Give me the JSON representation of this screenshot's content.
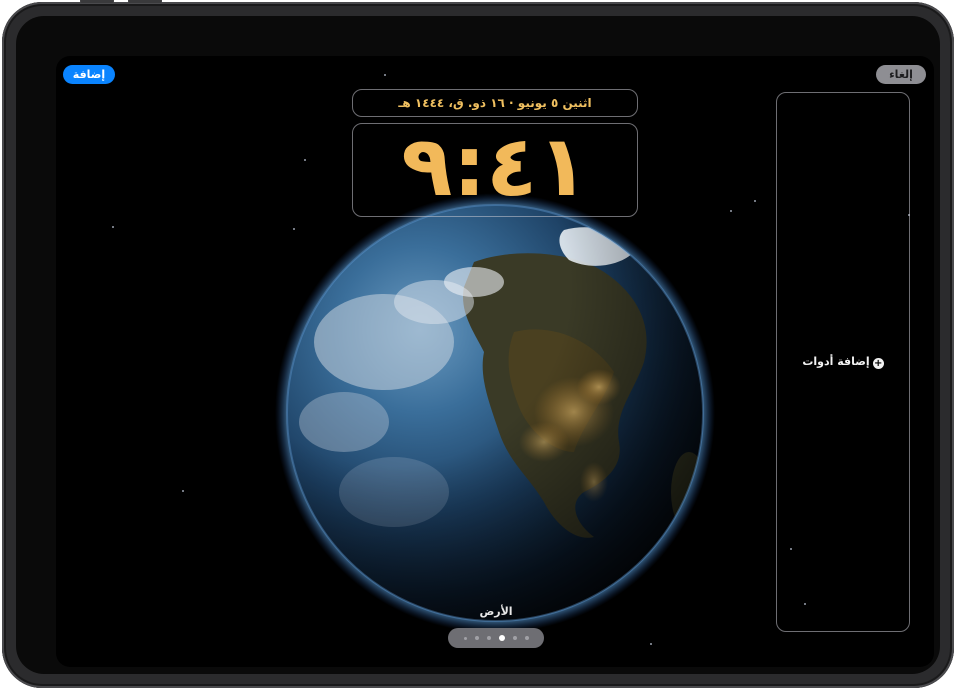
{
  "toolbar": {
    "add_label": "إضافة",
    "cancel_label": "إلغاء"
  },
  "lock_screen": {
    "date_text": "اثنين ٥ يونيو · ١٦ ذو. ق، ١٤٤٤ هـ",
    "time_text": "٩:٤١",
    "time_color": "#f2b95a"
  },
  "widgets": {
    "add_widgets_label": "إضافة أدوات"
  },
  "wallpaper": {
    "name": "الأرض",
    "page_count": 7,
    "active_page_index": 4
  },
  "colors": {
    "accent": "#0a84ff",
    "screen_background": "#000000"
  }
}
